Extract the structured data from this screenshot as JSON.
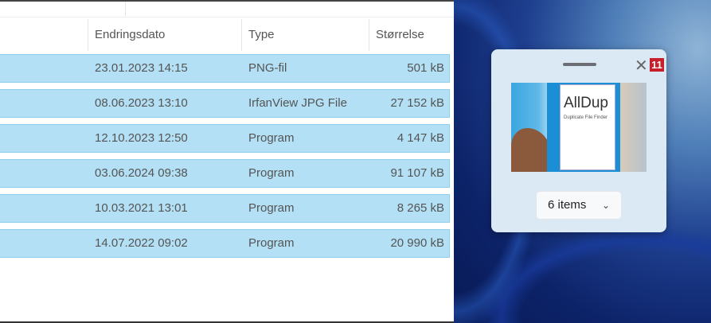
{
  "columns": {
    "date": "Endringsdato",
    "type": "Type",
    "size": "Størrelse"
  },
  "rows": [
    {
      "date": "23.01.2023 14:15",
      "type": "PNG-fil",
      "size": "501 kB"
    },
    {
      "date": "08.06.2023 13:10",
      "type": "IrfanView JPG File",
      "size": "27 152 kB"
    },
    {
      "date": "12.10.2023 12:50",
      "type": "Program",
      "size": "4 147 kB"
    },
    {
      "date": "03.06.2024 09:38",
      "type": "Program",
      "size": "91 107 kB"
    },
    {
      "date": "10.03.2021 13:01",
      "type": "Program",
      "size": "8 265 kB"
    },
    {
      "date": "14.07.2022 09:02",
      "type": "Program",
      "size": "20 990 kB"
    }
  ],
  "popup": {
    "close": "✕",
    "badge": "11",
    "thumb_logo": "AllDup",
    "thumb_sub": "Duplicate File Finder",
    "items_label": "6 items",
    "chevron": "⌄"
  }
}
